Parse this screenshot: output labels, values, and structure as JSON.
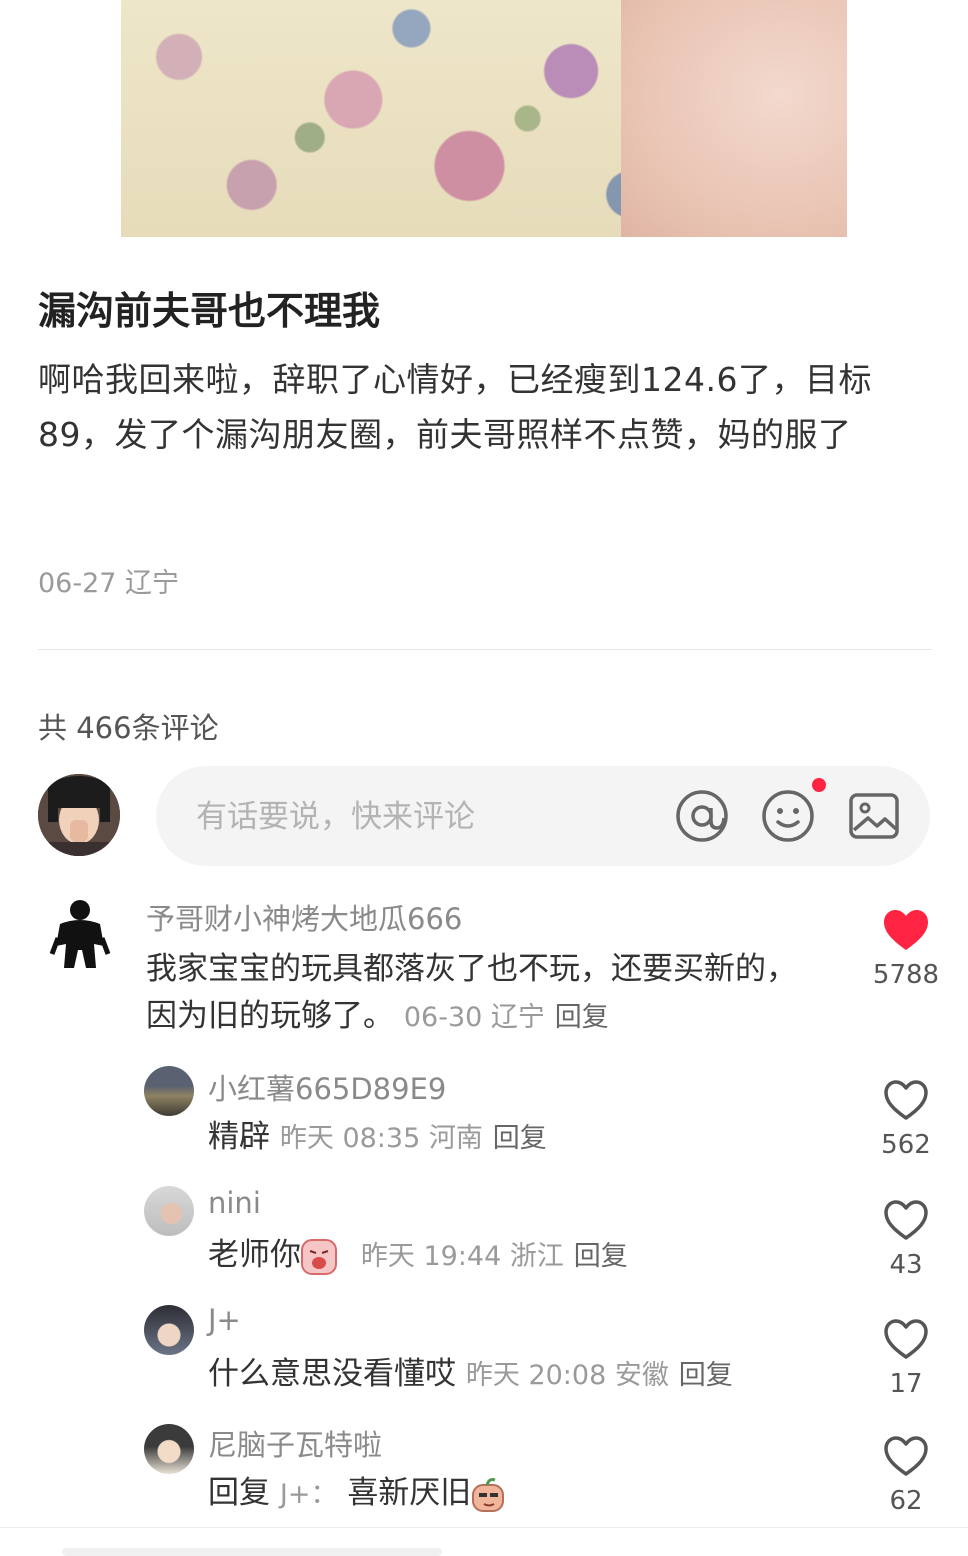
{
  "post": {
    "title": "漏沟前夫哥也不理我",
    "body": "啊哈我回来啦，辞职了心情好，已经瘦到124.6了，目标89，发了个漏沟朋友圈，前夫哥照样不点赞，妈的服了",
    "meta": "06-27 辽宁"
  },
  "comments_header": {
    "count_label": "共 466条评论"
  },
  "input": {
    "placeholder": "有话要说，快来评论",
    "at_label": "@"
  },
  "colors": {
    "accent": "#ff2442",
    "muted": "#9a9a9a"
  },
  "comments": [
    {
      "name": "予哥财小神烤大地瓜666",
      "text": "我家宝宝的玩具都落灰了也不玩，还要买新的，因为旧的玩够了。",
      "meta": "06-30 辽宁",
      "reply": "回复",
      "likes": "5788",
      "liked": true
    }
  ],
  "replies": [
    {
      "name": "小红薯665D89E9",
      "text": "精辟",
      "meta": "昨天 08:35 河南",
      "reply": "回复",
      "likes": "562"
    },
    {
      "name": "nini",
      "text": "老师你",
      "meta": "昨天 19:44 浙江",
      "reply": "回复",
      "likes": "43"
    },
    {
      "name": "J+",
      "text": "什么意思没看懂哎",
      "meta": "昨天 20:08 安徽",
      "reply": "回复",
      "likes": "17"
    },
    {
      "name": "尼脑子瓦特啦",
      "reply_prefix": "回复",
      "reply_to": "J+：",
      "text": "喜新厌旧",
      "likes": "62"
    }
  ]
}
